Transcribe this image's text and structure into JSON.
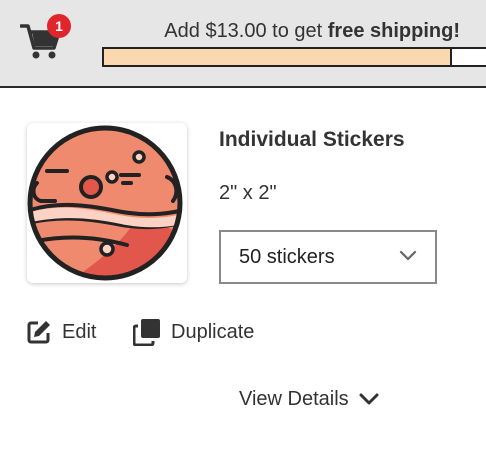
{
  "header": {
    "cart_count": "1",
    "shipping_prefix": "Add $13.00 to get ",
    "shipping_bold": "free shipping!",
    "shipping_progress": 0.91
  },
  "product": {
    "title": "Individual Stickers",
    "size": "2\" x 2\"",
    "quantity_selected": "50 stickers",
    "thumbnail_icon": "planet-sticker-icon"
  },
  "actions": {
    "edit_label": "Edit",
    "duplicate_label": "Duplicate",
    "view_details_label": "View Details"
  },
  "colors": {
    "header_bg": "#e6e6e6",
    "badge": "#e0262d",
    "progress_fill": "#fcd8b0",
    "planet": "#f08a6e",
    "planet_dark": "#e2574c"
  }
}
